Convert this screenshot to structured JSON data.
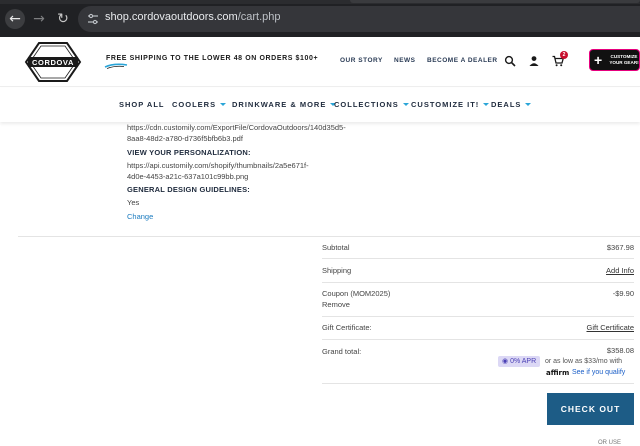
{
  "browser": {
    "url_host": "shop.cordovaoutdoors.com",
    "url_path": "/cart.php"
  },
  "header": {
    "logo_text": "CORDOVA",
    "promo": "FREE SHIPPING TO THE LOWER 48 ON ORDERS $100+",
    "links": [
      "OUR STORY",
      "NEWS",
      "BECOME A DEALER"
    ],
    "cart_count": "2",
    "customize_label": "CUSTOMIZE YOUR GEAR!"
  },
  "nav": {
    "items": [
      {
        "label": "SHOP ALL",
        "has_caret": false
      },
      {
        "label": "COOLERS",
        "has_caret": true
      },
      {
        "label": "DRINKWARE & MORE",
        "has_caret": true
      },
      {
        "label": "COLLECTIONS",
        "has_caret": true
      },
      {
        "label": "CUSTOMIZE IT!",
        "has_caret": true
      },
      {
        "label": "DEALS",
        "has_caret": true
      }
    ],
    "accent": "#2aa5d8"
  },
  "item_details": {
    "export_url_line1": "https://cdn.customily.com/ExportFile/CordovaOutdoors/140d35d5-",
    "export_url_line2": "8aa8-48d2-a780-d736f5bfb6b3.pdf",
    "view_label": "VIEW YOUR PERSONALIZATION:",
    "thumb_url_line1": "https://api.customily.com/shopify/thumbnails/2a5e671f-",
    "thumb_url_line2": "4d0e-4453-a21c-637a101c99bb.png",
    "guidelines_label": "GENERAL DESIGN GUIDELINES:",
    "guidelines_value": "Yes",
    "change_link": "Change"
  },
  "totals": {
    "subtotal_label": "Subtotal",
    "subtotal_value": "$367.98",
    "shipping_label": "Shipping",
    "shipping_value": "Add Info",
    "coupon_label": "Coupon (MOM2025)",
    "coupon_remove": "Remove",
    "coupon_value": "-$9.90",
    "gift_label": "Gift Certificate:",
    "gift_value": "Gift Certificate",
    "grand_label": "Grand total:",
    "grand_value": "$358.08"
  },
  "affirm": {
    "apr_badge": "0% APR",
    "as_low_as": "or as low as $33/mo with",
    "logo": "affirm",
    "qualify_link": "See if you qualify"
  },
  "checkout": {
    "button_label": "CHECK OUT",
    "below_text": "OR USE"
  },
  "colors": {
    "checkout_bg": "#1d5c86",
    "link": "#1b7bbf",
    "badge_red": "#c8102e"
  }
}
